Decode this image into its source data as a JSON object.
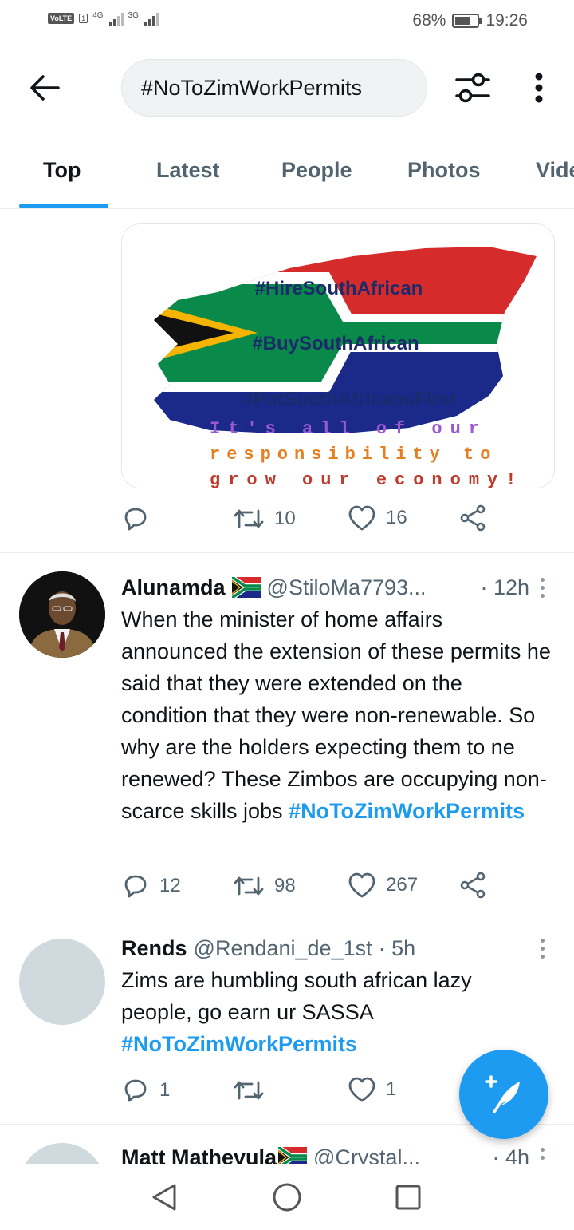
{
  "status_bar": {
    "volte": "VoLTE",
    "sim": "1",
    "net1": "4G",
    "net2": "3G",
    "battery_text": "68%",
    "battery_level": 0.68,
    "time": "19:26"
  },
  "header": {
    "back_icon": "arrow-left-icon",
    "search_value": "#NoToZimWorkPermits",
    "filter_icon": "sliders-icon",
    "more_icon": "more-vertical-icon"
  },
  "tabs": [
    "Top",
    "Latest",
    "People",
    "Photos",
    "Videos"
  ],
  "active_tab": "Top",
  "media_tweet": {
    "image_lines": [
      "#HireSouthAfrican",
      "#BuySouthAfrican",
      "#PutSouthAfricansFirst"
    ],
    "image_footer": [
      "It's all of our",
      "responsibility to",
      "grow our economy!"
    ],
    "stats": {
      "replies": "",
      "retweets": "10",
      "likes": "16"
    }
  },
  "tweets": [
    {
      "name": "Alunamda",
      "flag": "south-africa-flag-icon",
      "handle": "@StiloMa7793...",
      "time": "· 12h",
      "text": "When the minister of home affairs announced the extension of these permits he said that they were extended on the condition that they were non-renewable. So why are the holders expecting them to ne renewed? These Zimbos are occupying non-scarce skills jobs ",
      "hashtag": "#NoToZimWorkPermits",
      "stats": {
        "replies": "12",
        "retweets": "98",
        "likes": "267"
      }
    },
    {
      "name": "Rends",
      "handle": "@Rendani_de_1st",
      "time": "· 5h",
      "text": "Zims are humbling south african lazy people, go earn ur SASSA ",
      "hashtag": "#NoToZimWorkPermits",
      "stats": {
        "replies": "1",
        "retweets": "",
        "likes": "1"
      }
    },
    {
      "name": "Matt Mathevula",
      "flag": "south-africa-flag-icon",
      "handle": "@Crystal...",
      "time": "· 4h"
    }
  ],
  "fab_icon": "compose-tweet-icon",
  "nav": [
    "back-triangle-icon",
    "home-circle-icon",
    "recents-square-icon"
  ],
  "colors": {
    "accent": "#1d9bf0",
    "text": "#0f1419",
    "secondary": "#536471"
  }
}
